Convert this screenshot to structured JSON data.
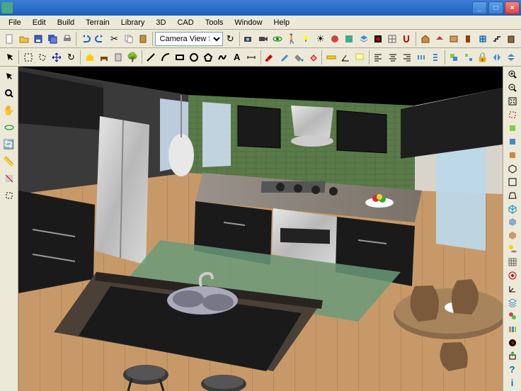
{
  "window": {
    "title": "",
    "minimize": "_",
    "maximize": "□",
    "close": "×"
  },
  "menu": {
    "items": [
      "File",
      "Edit",
      "Build",
      "Terrain",
      "Library",
      "3D",
      "CAD",
      "Tools",
      "Window",
      "Help"
    ]
  },
  "toolbar1": {
    "camera_dropdown": "Camera View Set",
    "icons": [
      "new",
      "open",
      "save",
      "save-all",
      "print",
      "undo",
      "redo",
      "cut",
      "copy",
      "paste",
      "delete",
      "zoom",
      "zoom-in",
      "zoom-out",
      "refresh",
      "measure",
      "move",
      "rotate",
      "mirror",
      "group",
      "ungroup",
      "layer",
      "materials",
      "light",
      "render",
      "snap",
      "grid",
      "orbit",
      "pan",
      "walk",
      "fly",
      "home",
      "roof",
      "wall",
      "door",
      "window",
      "stairs"
    ]
  },
  "toolbar2": {
    "icons": [
      "pointer",
      "select",
      "marquee",
      "lasso",
      "hand",
      "rect",
      "line",
      "arc",
      "poly",
      "circle",
      "text",
      "dim",
      "camera",
      "light2",
      "tree",
      "car",
      "person",
      "paint",
      "dropper",
      "erase",
      "fill",
      "spray",
      "pencil",
      "brush",
      "stamp",
      "clone",
      "blur",
      "sharpen",
      "smudge",
      "dodge",
      "align-l",
      "align-c",
      "align-r",
      "dist-h",
      "dist-v"
    ]
  },
  "left_tools": {
    "icons": [
      "arrow",
      "zoom",
      "pan",
      "orbit",
      "spin",
      "measure",
      "section",
      "clip"
    ]
  },
  "right_tools": {
    "icons": [
      "zoom-in",
      "zoom-out",
      "zoom-fit",
      "zoom-sel",
      "view-top",
      "view-front",
      "view-side",
      "view-iso",
      "ortho",
      "persp",
      "wire",
      "shade",
      "texture",
      "shadow",
      "grid",
      "snap",
      "axis",
      "layers",
      "mat",
      "lib",
      "render",
      "export",
      "help",
      "info"
    ]
  },
  "scene": {
    "description": "3D kitchen interior rendering",
    "floor_color": "#c89968",
    "wall_tile_color": "#5a7a4a",
    "cabinet_color": "#2a2a2a",
    "counter_color": "#8a8276",
    "island_top_color": "#4a4038",
    "rug_color": "#6a9a7a",
    "appliances": [
      "refrigerator",
      "range-hood",
      "stove",
      "oven",
      "sink"
    ],
    "furniture": [
      "island",
      "bar-stool",
      "bar-stool",
      "dining-table",
      "chair",
      "chair",
      "chair"
    ]
  }
}
